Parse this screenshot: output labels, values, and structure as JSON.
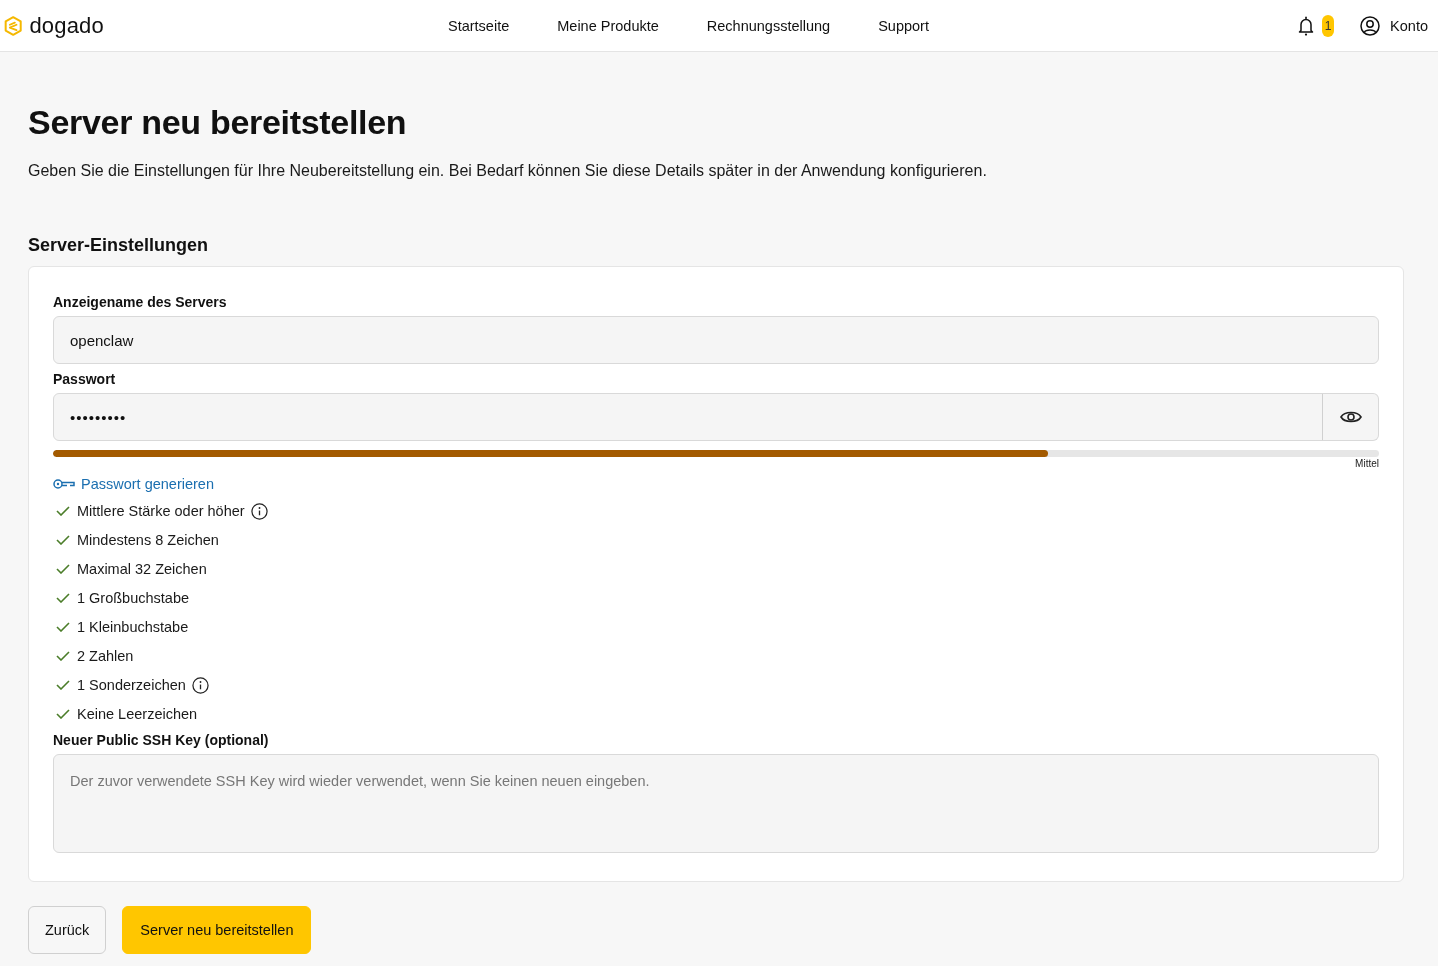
{
  "header": {
    "logo": "dogado",
    "nav": [
      "Startseite",
      "Meine Produkte",
      "Rechnungsstellung",
      "Support"
    ],
    "notifications": {
      "count": "1"
    },
    "account": {
      "label": "Konto"
    }
  },
  "page": {
    "title": "Server neu bereitstellen",
    "description": "Geben Sie die Einstellungen für Ihre Neubereitstellung ein. Bei Bedarf können Sie diese Details später in der Anwendung konfigurieren."
  },
  "section": {
    "title": "Server-Einstellungen"
  },
  "form": {
    "server_name": {
      "label": "Anzeigename des Servers",
      "value": "openclaw"
    },
    "password": {
      "label": "Passwort",
      "value": "•••••••••",
      "strength": {
        "level": 0.75,
        "label": "Mittel"
      },
      "generate_link": "Passwort generieren",
      "rules": [
        {
          "text": "Mittlere Stärke oder höher",
          "met": true,
          "info": true
        },
        {
          "text": "Mindestens 8 Zeichen",
          "met": true,
          "info": false
        },
        {
          "text": "Maximal 32 Zeichen",
          "met": true,
          "info": false
        },
        {
          "text": "1 Großbuchstabe",
          "met": true,
          "info": false
        },
        {
          "text": "1 Kleinbuchstabe",
          "met": true,
          "info": false
        },
        {
          "text": "2 Zahlen",
          "met": true,
          "info": false
        },
        {
          "text": "1 Sonderzeichen",
          "met": true,
          "info": true
        },
        {
          "text": "Keine Leerzeichen",
          "met": true,
          "info": false
        }
      ]
    },
    "ssh_key": {
      "label": "Neuer Public SSH Key (optional)",
      "placeholder": "Der zuvor verwendete SSH Key wird wieder verwendet, wenn Sie keinen neuen eingeben."
    }
  },
  "buttons": [
    {
      "label": "Zurück",
      "kind": "secondary"
    },
    {
      "label": "Server neu bereitstellen",
      "kind": "primary"
    }
  ]
}
